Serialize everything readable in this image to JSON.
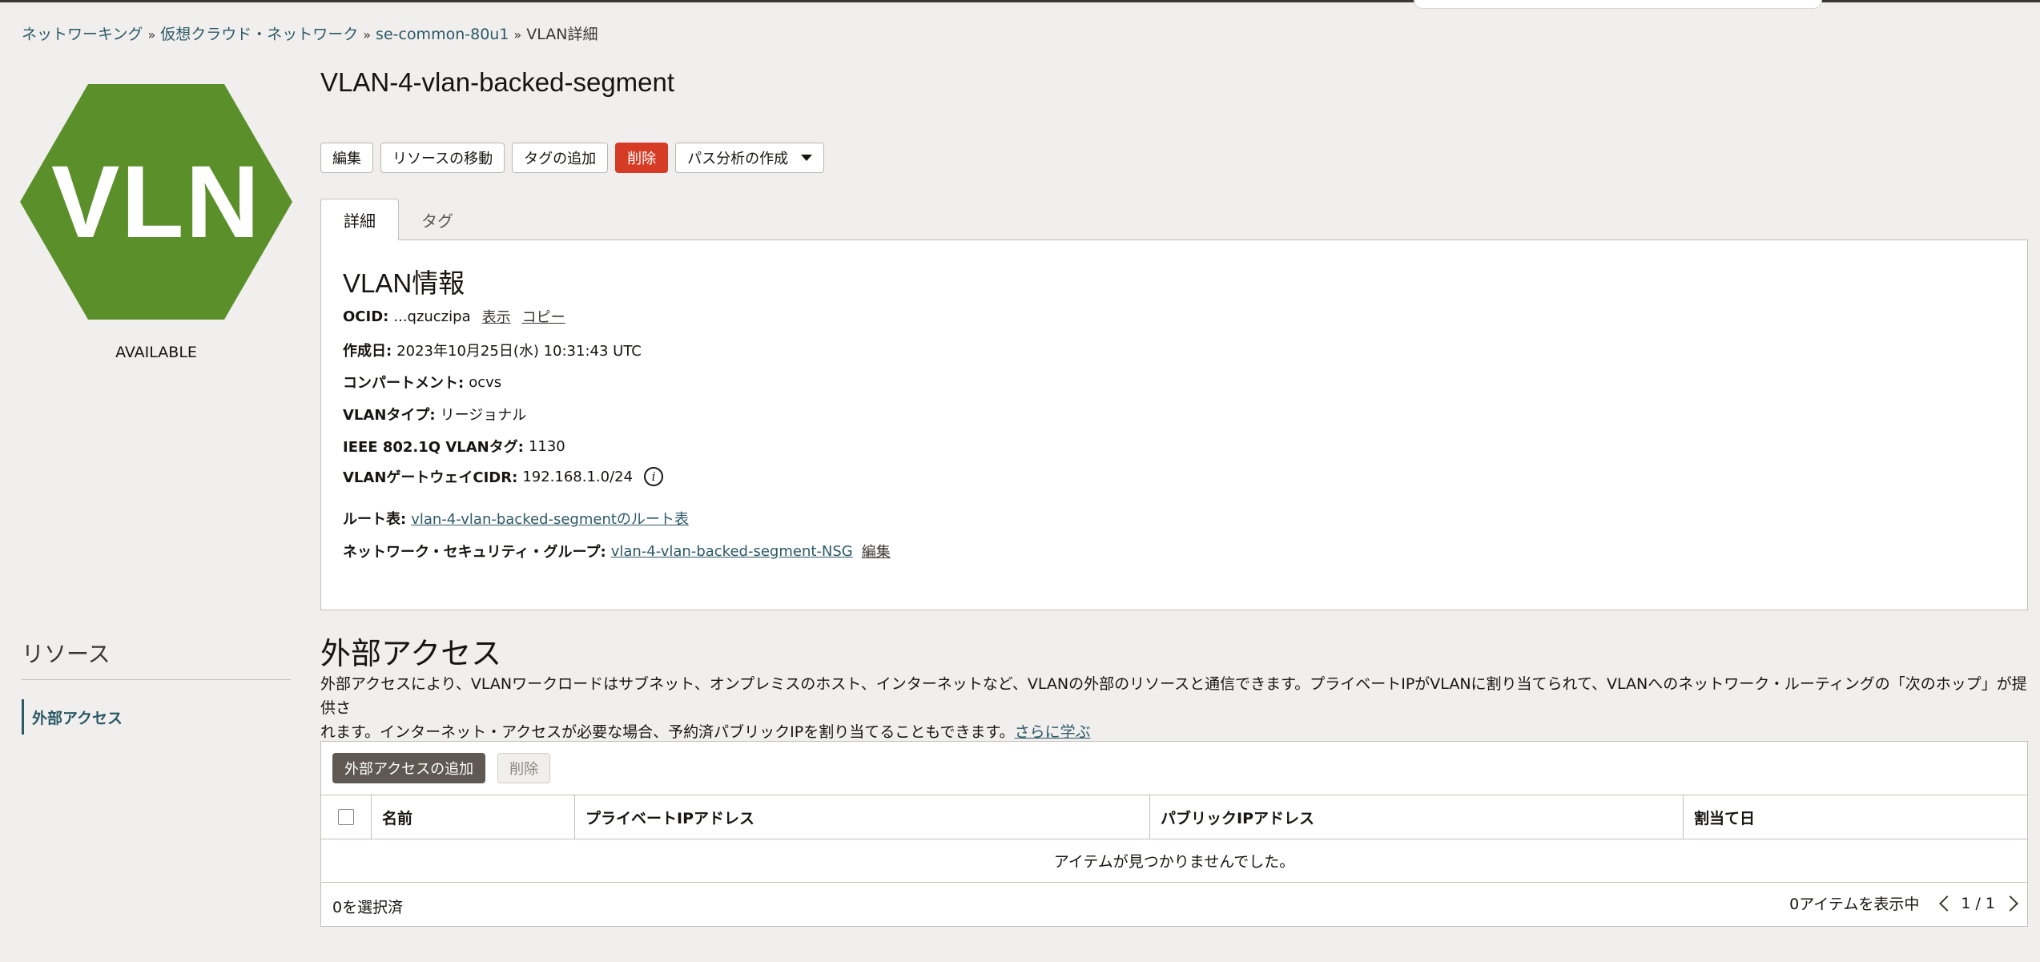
{
  "breadcrumb": {
    "items": [
      "ネットワーキング",
      "仮想クラウド・ネットワーク",
      "se-common-80u1"
    ],
    "current": "VLAN詳細",
    "separator": "»"
  },
  "resource_icon": {
    "text": "VLN",
    "color": "#5a8f29"
  },
  "status": "AVAILABLE",
  "title": "VLAN-4-vlan-backed-segment",
  "actions": {
    "edit": "編集",
    "move": "リソースの移動",
    "add_tags": "タグの追加",
    "delete": "削除",
    "path_analysis": "パス分析の作成"
  },
  "tabs": {
    "details": "詳細",
    "tags": "タグ"
  },
  "vlan_info": {
    "section_title": "VLAN情報",
    "ocid_label": "OCID:",
    "ocid_value": "...qzuczipa",
    "ocid_show": "表示",
    "ocid_copy": "コピー",
    "created_label": "作成日:",
    "created_value": "2023年10月25日(水) 10:31:43 UTC",
    "compartment_label": "コンパートメント:",
    "compartment_value": "ocvs",
    "type_label": "VLANタイプ:",
    "type_value": "リージョナル",
    "tag_label": "IEEE 802.1Q VLANタグ:",
    "tag_value": "1130",
    "cidr_label": "VLANゲートウェイCIDR:",
    "cidr_value": "192.168.1.0/24",
    "info_icon": "i",
    "route_label": "ルート表:",
    "route_value": "vlan-4-vlan-backed-segmentのルート表",
    "nsg_label": "ネットワーク・セキュリティ・グループ:",
    "nsg_value": "vlan-4-vlan-backed-segment-NSG",
    "nsg_edit": "編集"
  },
  "resources": {
    "title": "リソース",
    "item": "外部アクセス"
  },
  "external_access": {
    "title": "外部アクセス",
    "description_line1": "外部アクセスにより、VLANワークロードはサブネット、オンプレミスのホスト、インターネットなど、VLANの外部のリソースと通信できます。プライベートIPがVLANに割り当てられて、VLANへのネットワーク・ルーティングの「次のホップ」が提供さ",
    "description_line2": "れます。インターネット・アクセスが必要な場合、予約済パブリックIPを割り当てることもできます。",
    "learn_more": "さらに学ぶ"
  },
  "table": {
    "add_button": "外部アクセスの追加",
    "delete_button": "削除",
    "columns": [
      "名前",
      "プライベートIPアドレス",
      "パブリックIPアドレス",
      "割当て日"
    ],
    "empty_message": "アイテムが見つかりませんでした。",
    "selected": "0を選択済",
    "showing": "0アイテムを表示中",
    "pagination": "1 / 1"
  }
}
